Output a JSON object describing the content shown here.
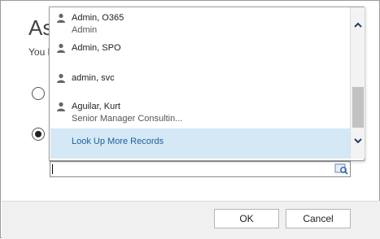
{
  "dialog": {
    "title": "As",
    "subtitle": "You h"
  },
  "lookup": {
    "results": [
      {
        "name": "Admin, O365",
        "subtitle": "Admin"
      },
      {
        "name": "Admin, SPO",
        "subtitle": ""
      },
      {
        "name": "admin, svc",
        "subtitle": ""
      },
      {
        "name": "Aguilar, Kurt",
        "subtitle": "Senior Manager Consultin..."
      }
    ],
    "look_up_more": "Look Up More Records",
    "input_value": ""
  },
  "footer": {
    "ok_label": "OK",
    "cancel_label": "Cancel"
  },
  "colors": {
    "highlight": "#d4e8f6",
    "link": "#1f5f9a"
  },
  "icons": [
    "person-icon",
    "lookup-search-icon",
    "scroll-up-icon",
    "scroll-down-icon"
  ]
}
